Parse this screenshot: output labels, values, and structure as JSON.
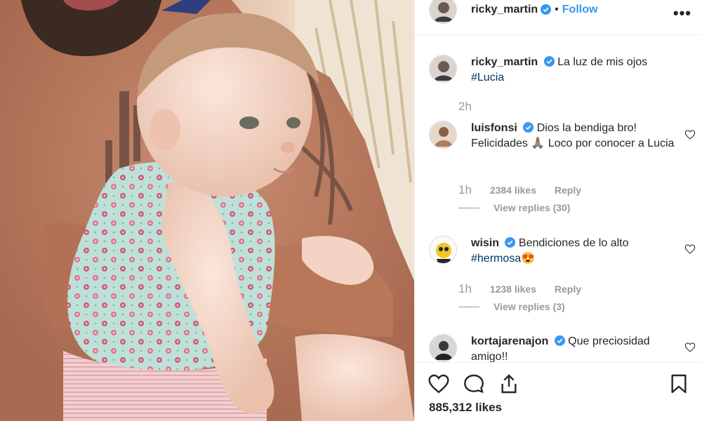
{
  "post": {
    "author": "ricky_martin",
    "follow_label": "Follow",
    "dot": "•",
    "more_label": "•••",
    "likes_count": "885,312 likes"
  },
  "colors": {
    "link_blue": "#3897f0",
    "hashtag": "#003569",
    "verified_badge": "#3897f0",
    "meta_gray": "#999999"
  },
  "caption": {
    "username": "ricky_martin",
    "text": "La luz de mis ojos",
    "hashtag": "#Lucia",
    "time": "2h"
  },
  "comments": [
    {
      "username": "luisfonsi",
      "text": "Dios la bendiga bro! Felicidades 🙏🏽  Loco por conocer a Lucia",
      "time": "1h",
      "likes": "2384 likes",
      "reply_label": "Reply",
      "view_replies": "View replies (30)"
    },
    {
      "username": "wisin",
      "text": "Bendiciones de lo alto",
      "hashtag": "#hermosa😍",
      "time": "1h",
      "likes": "1238 likes",
      "reply_label": "Reply",
      "view_replies": "View replies (3)"
    },
    {
      "username": "kortajarenajon",
      "text": "Que preciosidad amigo!!"
    }
  ],
  "icons": {
    "like": "heart-icon",
    "comment": "comment-icon",
    "share": "share-icon",
    "save": "bookmark-icon",
    "comment_like": "heart-outline-icon",
    "more": "more-options-icon",
    "verified": "verified-badge-icon"
  }
}
